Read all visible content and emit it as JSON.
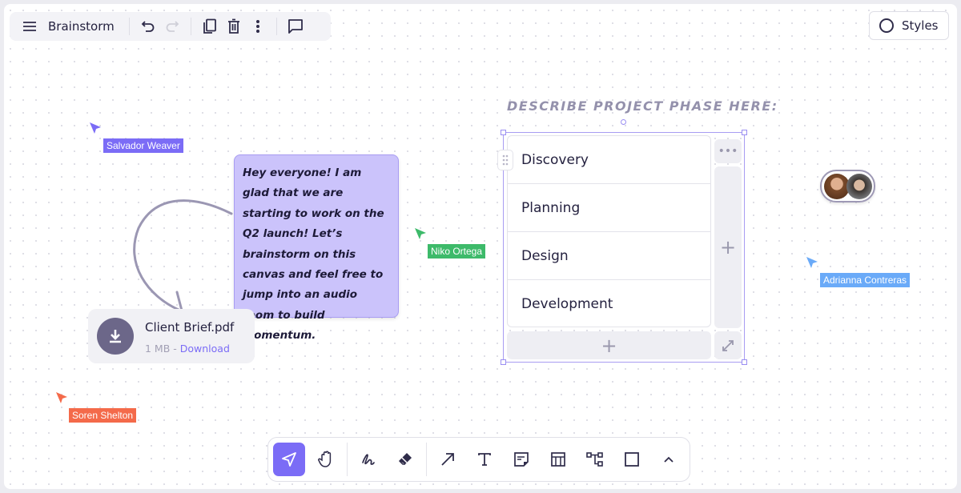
{
  "topbar": {
    "title": "Brainstorm",
    "icons": [
      "menu-icon",
      "undo-icon",
      "redo-icon",
      "copy-icon",
      "trash-icon",
      "more-vertical-icon",
      "comment-icon"
    ]
  },
  "styles_button": {
    "label": "Styles",
    "icon": "circle-icon"
  },
  "cursors": [
    {
      "name": "Salvador Weaver",
      "color": "#7b6cf6"
    },
    {
      "name": "Niko Ortega",
      "color": "#3dba6a"
    },
    {
      "name": "Adrianna Contreras",
      "color": "#6aaaf8"
    },
    {
      "name": "Soren Shelton",
      "color": "#f46a4a"
    }
  ],
  "sticky_note": {
    "text": "Hey everyone! I am glad that we are starting to work on the Q2 launch! Let’s brainstorm on this canvas and feel free to jump into an audio room to build momentum.",
    "color": "#cbc3fb"
  },
  "file": {
    "name": "Client Brief.pdf",
    "size": "1 MB -",
    "download_label": "Download"
  },
  "phase": {
    "title": "DESCRIBE PROJECT PHASE HERE:",
    "items": [
      "Discovery",
      "Planning",
      "Design",
      "Development"
    ]
  },
  "toolbar": {
    "tools": [
      "select-icon",
      "hand-icon",
      "pen-icon",
      "eraser-icon",
      "arrow-icon",
      "text-icon",
      "sticky-note-icon",
      "table-icon",
      "diagram-icon",
      "rectangle-icon",
      "chevron-up-icon"
    ],
    "active": "select-icon",
    "accent": "#7b6cf6"
  }
}
